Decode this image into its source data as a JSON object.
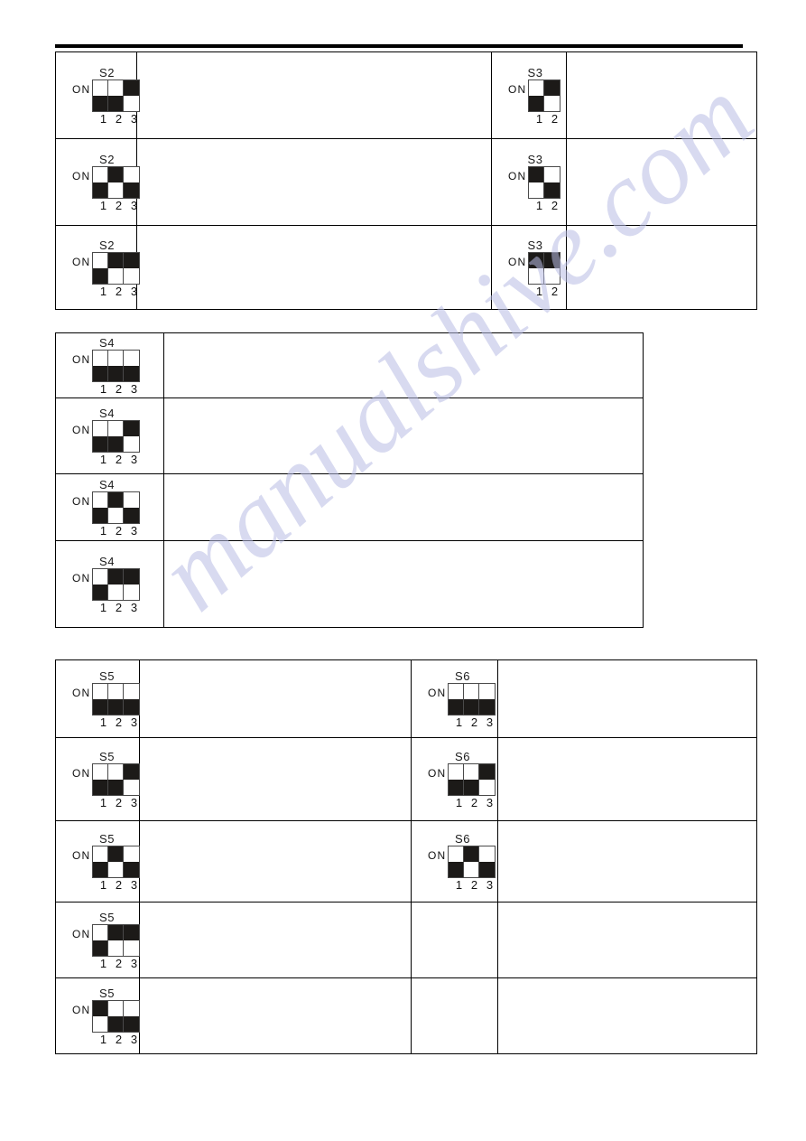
{
  "page": {
    "background_color": "#ffffff",
    "watermark_text": "manualshive.com",
    "watermark_color": "#b9bde4"
  },
  "switch_legend": {
    "on_label": "ON",
    "position_labels_3": [
      "1",
      "2",
      "3"
    ],
    "position_labels_2": [
      "1",
      "2"
    ],
    "on_color": "#1c1a18",
    "off_color": "#ffffff"
  },
  "tables": [
    {
      "id": "table-s2-s3",
      "columns": 4,
      "rows": [
        {
          "switch_a": {
            "name": "S2",
            "on_label": "ON",
            "positions": [
              "1",
              "2",
              "3"
            ],
            "states": [
              "off",
              "off",
              "on"
            ]
          },
          "text_a": "",
          "switch_b": {
            "name": "S3",
            "on_label": "ON",
            "positions": [
              "1",
              "2"
            ],
            "states": [
              "off",
              "on"
            ]
          },
          "text_b": ""
        },
        {
          "switch_a": {
            "name": "S2",
            "on_label": "ON",
            "positions": [
              "1",
              "2",
              "3"
            ],
            "states": [
              "off",
              "on",
              "off"
            ]
          },
          "text_a": "",
          "switch_b": {
            "name": "S3",
            "on_label": "ON",
            "positions": [
              "1",
              "2"
            ],
            "states": [
              "on",
              "off"
            ]
          },
          "text_b": ""
        },
        {
          "switch_a": {
            "name": "S2",
            "on_label": "ON",
            "positions": [
              "1",
              "2",
              "3"
            ],
            "states": [
              "off",
              "on",
              "on"
            ]
          },
          "text_a": "",
          "switch_b": {
            "name": "S3",
            "on_label": "ON",
            "positions": [
              "1",
              "2"
            ],
            "states": [
              "on",
              "on"
            ]
          },
          "text_b": ""
        }
      ]
    },
    {
      "id": "table-s4",
      "columns": 2,
      "rows": [
        {
          "switch_a": {
            "name": "S4",
            "on_label": "ON",
            "positions": [
              "1",
              "2",
              "3"
            ],
            "states": [
              "off",
              "off",
              "off"
            ]
          },
          "text_a": ""
        },
        {
          "switch_a": {
            "name": "S4",
            "on_label": "ON",
            "positions": [
              "1",
              "2",
              "3"
            ],
            "states": [
              "off",
              "off",
              "on"
            ]
          },
          "text_a": ""
        },
        {
          "switch_a": {
            "name": "S4",
            "on_label": "ON",
            "positions": [
              "1",
              "2",
              "3"
            ],
            "states": [
              "off",
              "on",
              "off"
            ]
          },
          "text_a": ""
        },
        {
          "switch_a": {
            "name": "S4",
            "on_label": "ON",
            "positions": [
              "1",
              "2",
              "3"
            ],
            "states": [
              "off",
              "on",
              "on"
            ]
          },
          "text_a": ""
        }
      ]
    },
    {
      "id": "table-s5-s6",
      "columns": 4,
      "rows": [
        {
          "switch_a": {
            "name": "S5",
            "on_label": "ON",
            "positions": [
              "1",
              "2",
              "3"
            ],
            "states": [
              "off",
              "off",
              "off"
            ]
          },
          "text_a": "",
          "switch_b": {
            "name": "S6",
            "on_label": "ON",
            "positions": [
              "1",
              "2",
              "3"
            ],
            "states": [
              "off",
              "off",
              "off"
            ]
          },
          "text_b": ""
        },
        {
          "switch_a": {
            "name": "S5",
            "on_label": "ON",
            "positions": [
              "1",
              "2",
              "3"
            ],
            "states": [
              "off",
              "off",
              "on"
            ]
          },
          "text_a": "",
          "switch_b": {
            "name": "S6",
            "on_label": "ON",
            "positions": [
              "1",
              "2",
              "3"
            ],
            "states": [
              "off",
              "off",
              "on"
            ]
          },
          "text_b": ""
        },
        {
          "switch_a": {
            "name": "S5",
            "on_label": "ON",
            "positions": [
              "1",
              "2",
              "3"
            ],
            "states": [
              "off",
              "on",
              "off"
            ]
          },
          "text_a": "",
          "switch_b": {
            "name": "S6",
            "on_label": "ON",
            "positions": [
              "1",
              "2",
              "3"
            ],
            "states": [
              "off",
              "on",
              "off"
            ]
          },
          "text_b": ""
        },
        {
          "switch_a": {
            "name": "S5",
            "on_label": "ON",
            "positions": [
              "1",
              "2",
              "3"
            ],
            "states": [
              "off",
              "on",
              "on"
            ]
          },
          "text_a": "",
          "switch_b": null,
          "text_b": ""
        },
        {
          "switch_a": {
            "name": "S5",
            "on_label": "ON",
            "positions": [
              "1",
              "2",
              "3"
            ],
            "states": [
              "on",
              "off",
              "off"
            ]
          },
          "text_a": "",
          "switch_b": null,
          "text_b": ""
        }
      ]
    }
  ]
}
